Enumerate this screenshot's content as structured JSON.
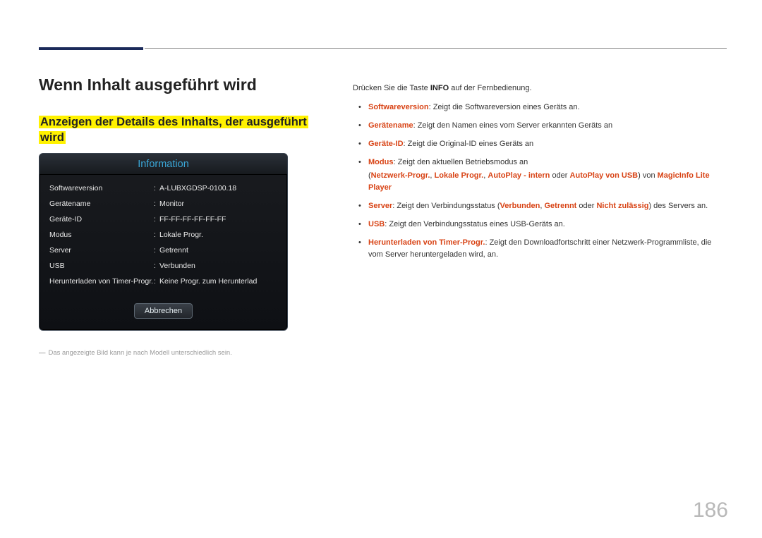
{
  "page_number": "186",
  "heading": "Wenn Inhalt ausgeführt wird",
  "subheading_line1": "Anzeigen der Details des Inhalts, der ausgeführt",
  "subheading_line2": "wird",
  "panel": {
    "title": "Information",
    "rows": [
      {
        "label": "Softwareversion",
        "value": "A-LUBXGDSP-0100.18"
      },
      {
        "label": "Gerätename",
        "value": "Monitor"
      },
      {
        "label": "Geräte-ID",
        "value": "FF-FF-FF-FF-FF-FF"
      },
      {
        "label": "Modus",
        "value": "Lokale Progr."
      },
      {
        "label": "Server",
        "value": "Getrennt"
      },
      {
        "label": "USB",
        "value": "Verbunden"
      },
      {
        "label": "Herunterladen von Timer-Progr.",
        "value": "Keine Progr. zum Herunterlad"
      }
    ],
    "button": "Abbrechen"
  },
  "caption": "Das angezeigte Bild kann je nach Modell unterschiedlich sein.",
  "intro": {
    "pre": "Drücken Sie die Taste ",
    "bold": "INFO",
    "post": " auf der Fernbedienung."
  },
  "bullets": {
    "b0": {
      "term": "Softwareversion",
      "rest": ": Zeigt die Softwareversion eines Geräts an."
    },
    "b1": {
      "term": "Gerätename",
      "rest": ": Zeigt den Namen eines vom Server erkannten Geräts an"
    },
    "b2": {
      "term": "Geräte-ID",
      "rest": ": Zeigt die Original-ID eines Geräts an"
    },
    "b3": {
      "term": "Modus",
      "rest": ": Zeigt den aktuellen Betriebsmodus an",
      "sub_open": "(",
      "s1": "Netzwerk-Progr.",
      "c1": ", ",
      "s2": "Lokale Progr.",
      "c2": ", ",
      "s3": "AutoPlay - intern",
      "mid": " oder ",
      "s4": "AutoPlay von USB",
      "post": ") von ",
      "s5": "MagicInfo Lite Player"
    },
    "b4": {
      "term": "Server",
      "pre": ": Zeigt den Verbindungsstatus (",
      "s1": "Verbunden",
      "c1": ", ",
      "s2": "Getrennt",
      "mid": " oder ",
      "s3": "Nicht zulässig",
      "post": ") des Servers an."
    },
    "b5": {
      "term": "USB",
      "rest": ": Zeigt den Verbindungsstatus eines USB-Geräts an."
    },
    "b6": {
      "term": "Herunterladen von Timer-Progr.",
      "rest": ": Zeigt den Downloadfortschritt einer Netzwerk-Programmliste, die vom Server heruntergeladen wird, an."
    }
  }
}
